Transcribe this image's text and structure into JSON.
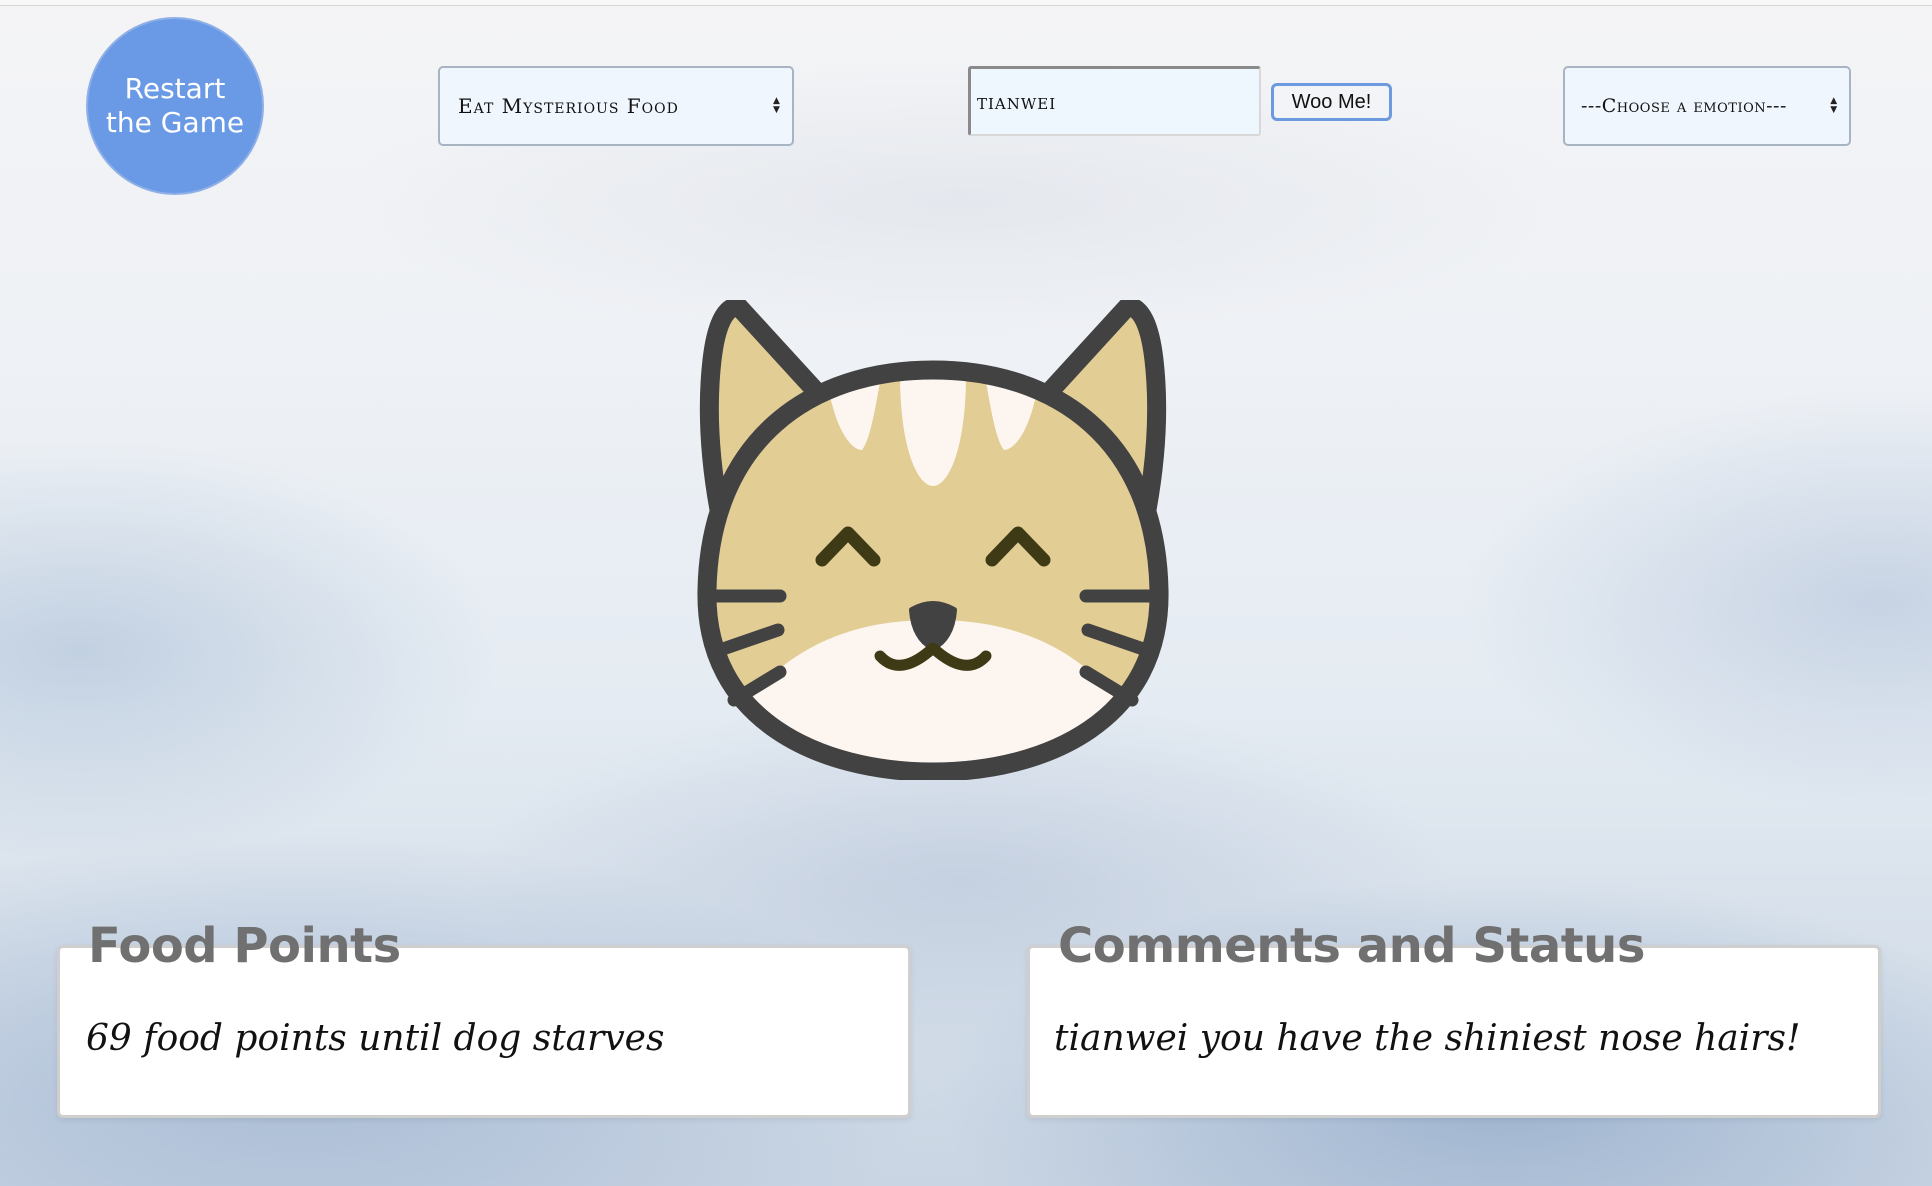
{
  "header": {
    "restart_label": "Restart the Game",
    "food_select_value": "Eat Mysterious Food",
    "name_input_value": "tianwei",
    "woo_button_label": "Woo Me!",
    "emotion_select_value": "---Choose a emotion---"
  },
  "pet": {
    "icon": "happy-cat-face-icon",
    "colors": {
      "outline": "#424242",
      "fur": "#e2cd95",
      "muzzle": "#fdf6f0",
      "features": "#3e3a16"
    }
  },
  "food_panel": {
    "title": "Food Points",
    "text": "69 food points until dog starves"
  },
  "status_panel": {
    "title": "Comments and Status",
    "text": "tianwei you have the shiniest nose hairs!"
  },
  "colors": {
    "restart_button": "#6a9ae6",
    "select_background": "#eff6fd",
    "title_gray": "#707070"
  }
}
